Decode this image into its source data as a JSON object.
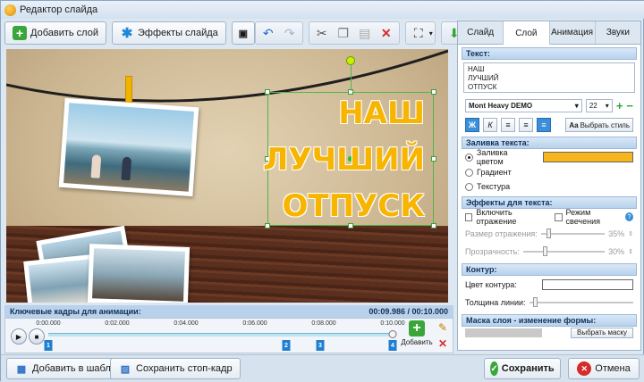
{
  "window": {
    "title": "Редактор слайда"
  },
  "toolbar": {
    "add_layer": "Добавить слой",
    "slide_effects": "Эффекты слайда"
  },
  "slide": {
    "text_lines": [
      "НАШ",
      "ЛУЧШИЙ",
      "ОТПУСК"
    ]
  },
  "timeline": {
    "header": "Ключевые кадры для анимации:",
    "time": "00:09.986 / 00:10.000",
    "ticks": [
      "0:00.000",
      "0:02.000",
      "0:04.000",
      "0:06.000",
      "0:08.000",
      "0:10.000"
    ],
    "keyframes": [
      "1",
      "2",
      "3",
      "4"
    ],
    "add_label": "Добавить"
  },
  "panel": {
    "tabs": [
      "Слайд",
      "Слой",
      "Анимация",
      "Звуки"
    ],
    "active_tab": "Слой",
    "text_section": "Текст:",
    "text_value": "НАШ\nЛУЧШИЙ\nОТПУСК",
    "font": "Mont Heavy DEMO",
    "font_size": "22",
    "style_button": "Выбрать стиль",
    "fill_section": "Заливка текста:",
    "fill_color_label": "Заливка цветом",
    "fill_color": "#f7b51d",
    "gradient_label": "Градиент",
    "texture_label": "Текстура",
    "effects_section": "Эффекты для текста:",
    "reflection_label": "Включить отражение",
    "glow_label": "Режим свечения",
    "reflection_size_label": "Размер отражения:",
    "reflection_size_value": "35%",
    "transparency_label": "Прозрачность:",
    "transparency_value": "30%",
    "outline_section": "Контур:",
    "outline_color_label": "Цвет контура:",
    "outline_width_label": "Толщина линии:",
    "mask_section": "Маска слоя - изменение формы:",
    "mask_button": "Выбрать маску"
  },
  "bottom": {
    "add_templates": "Добавить в шаблоны",
    "save_frame": "Сохранить стоп-кадр",
    "save": "Сохранить",
    "cancel": "Отмена"
  },
  "colors": {
    "accent_blue": "#1e7fd0",
    "text_yellow": "#f7b500"
  }
}
